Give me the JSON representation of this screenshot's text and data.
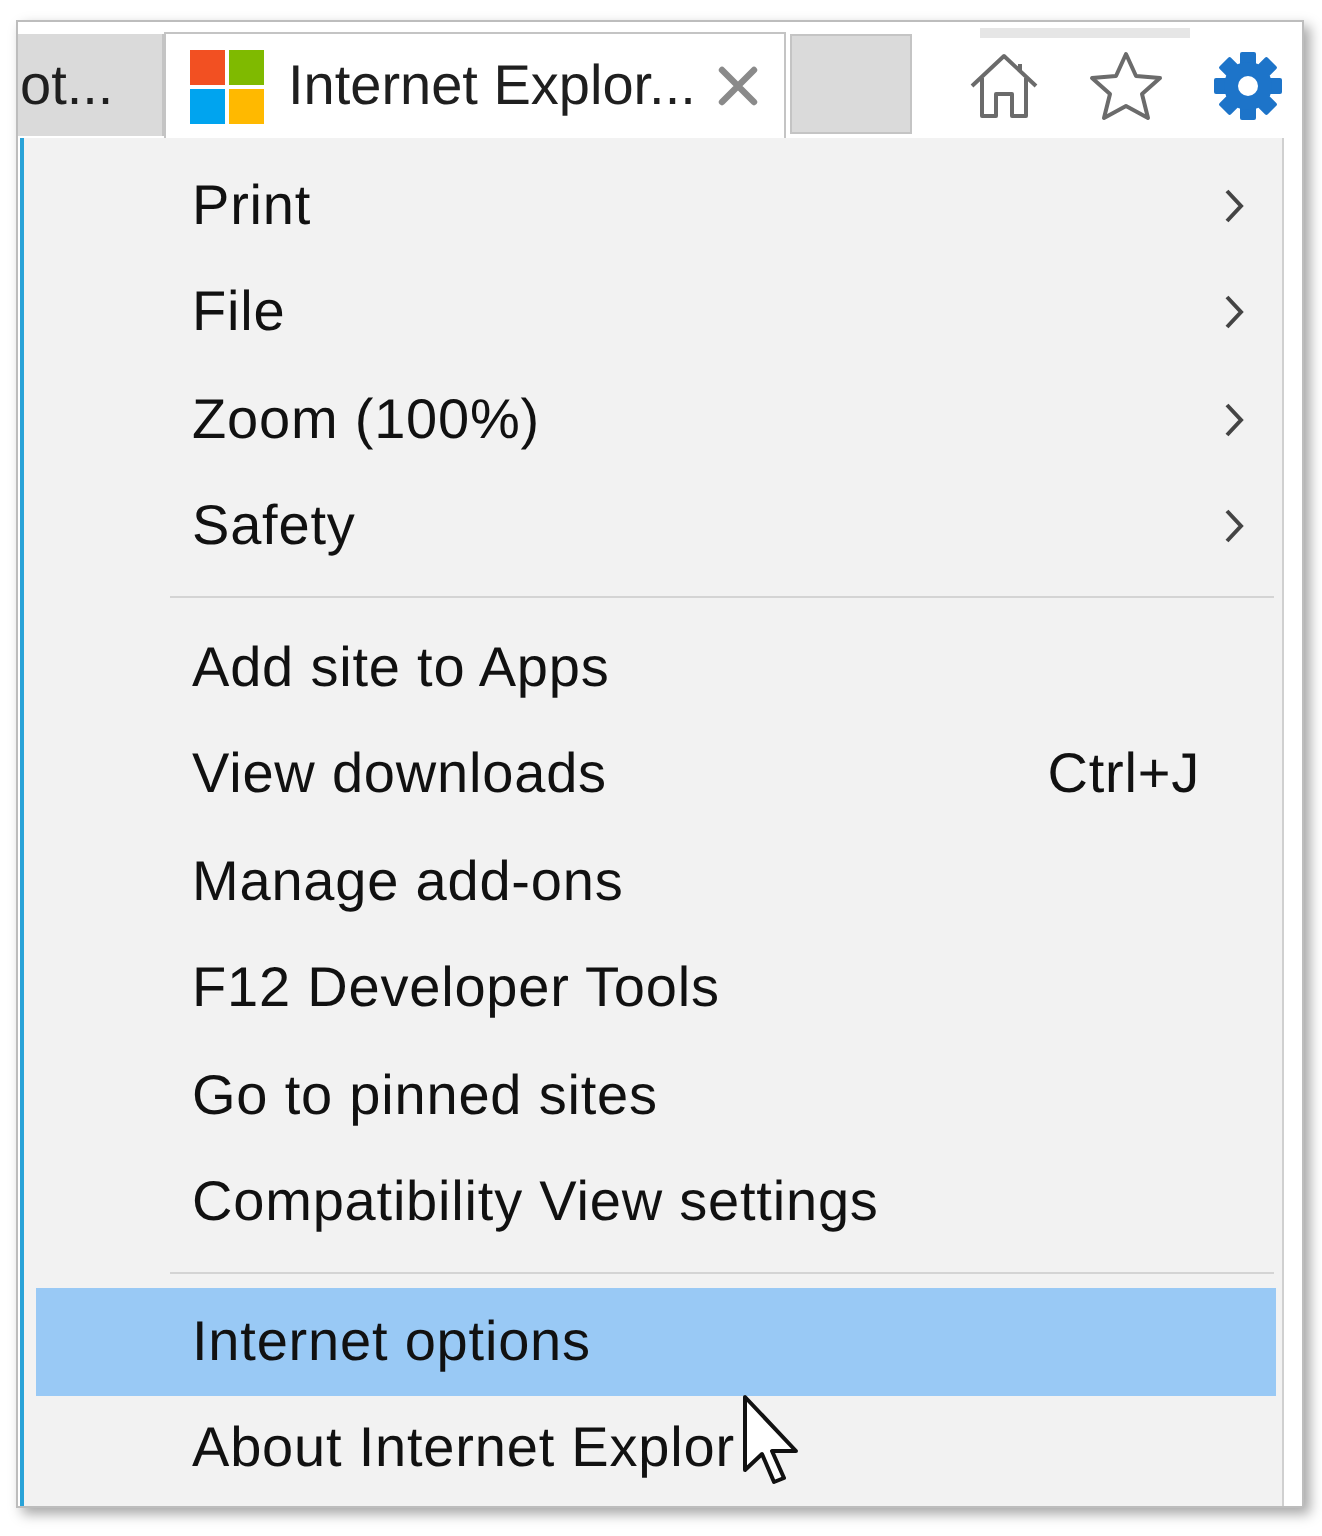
{
  "tabs": [
    {
      "title": "ot...",
      "selected": false
    },
    {
      "title": "Internet Explor...",
      "selected": true
    }
  ],
  "menu": {
    "groups": [
      {
        "items": [
          {
            "label": "Print",
            "submenu": true,
            "selected": false
          },
          {
            "label": "File",
            "submenu": true,
            "selected": false
          },
          {
            "label": "Zoom (100%)",
            "submenu": true,
            "selected": false
          },
          {
            "label": "Safety",
            "submenu": true,
            "selected": false
          }
        ]
      },
      {
        "items": [
          {
            "label": "Add site to Apps",
            "submenu": false,
            "selected": false
          },
          {
            "label": "View downloads",
            "shortcut": "Ctrl+J",
            "submenu": false,
            "selected": false
          },
          {
            "label": "Manage add-ons",
            "submenu": false,
            "selected": false
          },
          {
            "label": "F12 Developer Tools",
            "submenu": false,
            "selected": false
          },
          {
            "label": "Go to pinned sites",
            "submenu": false,
            "selected": false
          },
          {
            "label": "Compatibility View settings",
            "submenu": false,
            "selected": false
          }
        ]
      },
      {
        "items": [
          {
            "label": "Internet options",
            "submenu": false,
            "selected": true
          },
          {
            "label": "About Internet Explor",
            "submenu": false,
            "selected": false
          }
        ]
      }
    ]
  }
}
